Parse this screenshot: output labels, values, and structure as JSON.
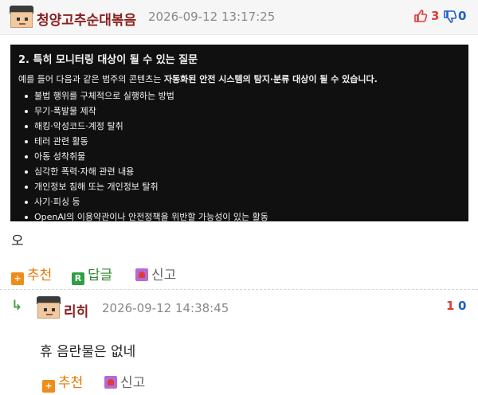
{
  "post": {
    "author": "청양고추순대볶음",
    "timestamp": "2026-09-12 13:17:25",
    "upvotes": "3",
    "downvotes": "0",
    "colors": {
      "up": "#e23a3a",
      "down": "#1f5fc9"
    }
  },
  "callout": {
    "title": "2. 특히 모니터링 대상이 될 수 있는 질문",
    "intro_prefix": "예를 들어 다음과 같은 범주의 콘텐츠는 ",
    "intro_bold": "자동화된 안전 시스템의 탐지·분류 대상이 될 수 있습니다.",
    "items": [
      "불법 행위를 구체적으로 실행하는 방법",
      "무기·폭발물 제작",
      "해킹·악성코드·계정 탈취",
      "테러 관련 활동",
      "아동 성착취물",
      "심각한 폭력·자해 관련 내용",
      "개인정보 침해 또는 개인정보 탈취",
      "사기·피싱 등",
      "OpenAI의 이용약관이나 안전정책을 위반할 가능성이 있는 활동"
    ]
  },
  "post_body": "오",
  "actions": {
    "recommend": "추천",
    "reply": "답글",
    "report": "신고",
    "icons": [
      "plus-icon",
      "reply-icon",
      "siren-icon"
    ]
  },
  "comment": {
    "reply_marker": "↳",
    "author": "리히",
    "timestamp": "2026-09-12 14:38:45",
    "upvotes": "1",
    "downvotes": "0",
    "body": "휴 음란물은 없네",
    "recommend": "추천",
    "report": "신고"
  }
}
